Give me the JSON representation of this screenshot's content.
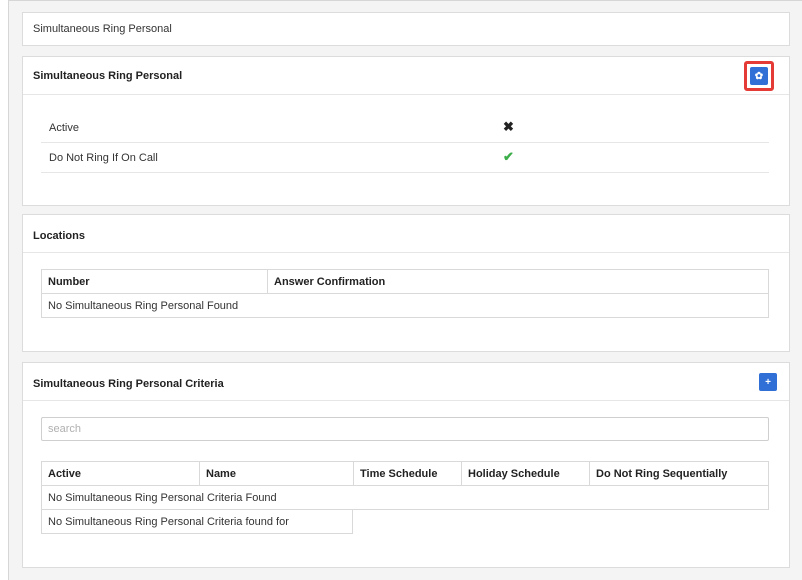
{
  "breadcrumb": "Simultaneous Ring Personal",
  "settings_panel": {
    "title": "Simultaneous Ring Personal",
    "settings_icon": "gear-icon",
    "rows": [
      {
        "label": "Active",
        "status": "✖",
        "status_meaning": "disabled"
      },
      {
        "label": "Do Not Ring If On Call",
        "status": "✔",
        "status_meaning": "enabled"
      }
    ]
  },
  "locations_panel": {
    "title": "Locations",
    "columns": [
      "Number",
      "Answer Confirmation"
    ],
    "empty_message": "No Simultaneous Ring Personal Found"
  },
  "criteria_panel": {
    "title": "Simultaneous Ring Personal Criteria",
    "add_icon": "plus-icon",
    "search_placeholder": "search",
    "columns": [
      "Active",
      "Name",
      "Time Schedule",
      "Holiday Schedule",
      "Do Not Ring Sequentially"
    ],
    "empty_message": "No Simultaneous Ring Personal Criteria Found",
    "empty_message_2": "No Simultaneous Ring Personal Criteria found for"
  },
  "colors": {
    "accent": "#2f6fd6",
    "highlight": "#e53b36",
    "check": "#3cae4a"
  }
}
